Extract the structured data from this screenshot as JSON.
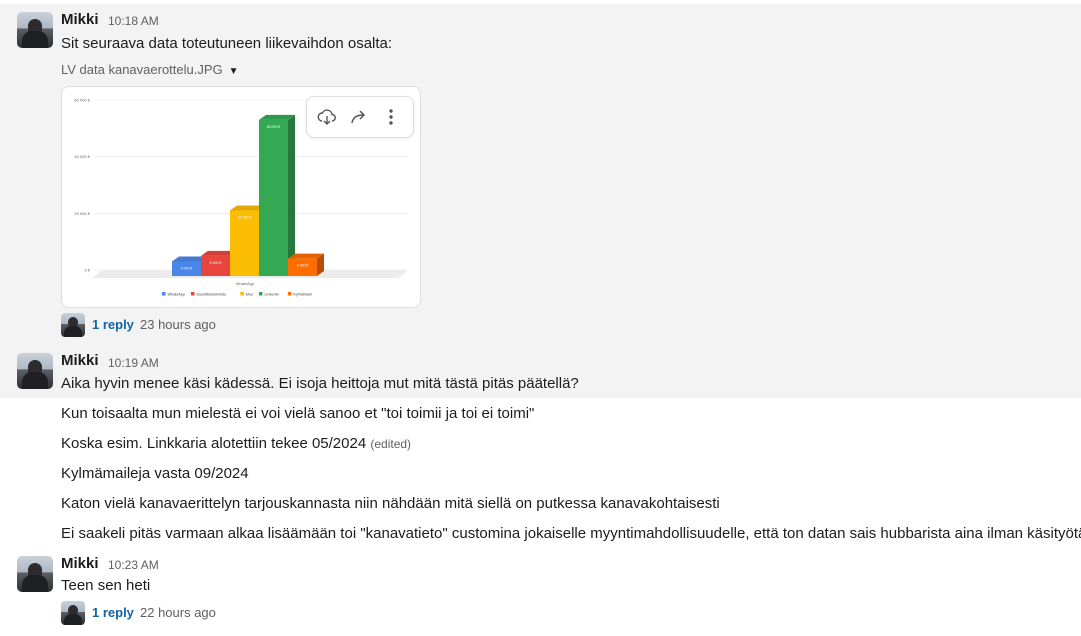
{
  "messages": [
    {
      "author": "Mikki",
      "time": "10:18 AM",
      "text": "Sit seuraava data toteutuneen liikevaihdon osalta:",
      "attachment": {
        "filename": "LV data kanavaerottelu.JPG"
      },
      "thread": {
        "count": "1 reply",
        "last": "23 hours ago"
      }
    },
    {
      "author": "Mikki",
      "time": "10:19 AM",
      "text": "Aika hyvin menee käsi kädessä. Ei isoja heittoja mut mitä tästä pitäs päätellä?"
    },
    {
      "lines": [
        "Kun toisaalta mun mielestä ei voi vielä sanoo et \"toi toimii ja toi ei toimi\"",
        "Koska esim. Linkkaria alotettiin tekee 05/2024",
        "Kylmämaileja vasta 09/2024",
        "Katon vielä kanavaerittelyn tarjouskannasta niin nähdään mitä siellä on putkessa kanavakohtaisesti",
        "Ei saakeli pitäs varmaan alkaa lisäämään toi \"kanavatieto\" customina jokaiselle myyntimahdollisuudelle, että ton datan sais hubbarista aina ilman käsityötä"
      ],
      "edited_label": "(edited)"
    },
    {
      "author": "Mikki",
      "time": "10:23 AM",
      "text": "Teen sen heti",
      "thread": {
        "count": "1 reply",
        "last": "22 hours ago"
      }
    }
  ],
  "chart_data": {
    "type": "bar",
    "categories": [
      "WhatsApp"
    ],
    "xlabel": "WhatsApp",
    "ylim": [
      0,
      60000
    ],
    "yticks": [
      "0 €",
      "20 000 €",
      "40 000 €",
      "60 000 €"
    ],
    "series": [
      {
        "name": "WhatsApp",
        "values": [
          3000
        ],
        "label": "3 000 €",
        "color": "#4a86e8"
      },
      {
        "name": "Suosittelutoimisto",
        "values": [
          5000
        ],
        "label": "5 000 €",
        "color": "#e8453c"
      },
      {
        "name": "Muu",
        "values": [
          21000
        ],
        "label": "21 000 €",
        "color": "#fbbc04"
      },
      {
        "name": "LinkedIn",
        "values": [
          53000
        ],
        "label": "53 000 €",
        "color": "#34a853"
      },
      {
        "name": "Kylmämaili",
        "values": [
          4000
        ],
        "label": "4 000 €",
        "color": "#ff6d01"
      }
    ]
  }
}
